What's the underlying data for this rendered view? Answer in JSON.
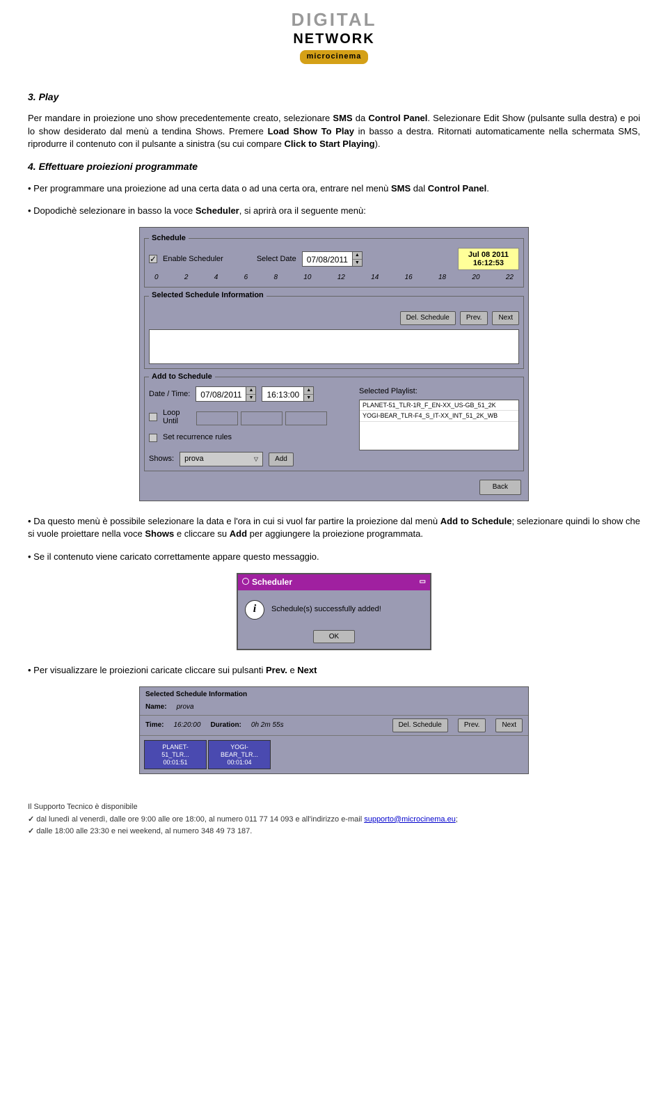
{
  "logo": {
    "line1": "DIGITAL",
    "line2": "NETWORK",
    "line3": "microcinema"
  },
  "sec3": {
    "title": "3. Play",
    "p1a": "Per mandare in proiezione uno show precedentemente creato, selezionare ",
    "p1b": "SMS",
    "p1c": " da ",
    "p1d": "Control Panel",
    "p1e": ". Selezionare Edit Show (pulsante sulla destra) e poi lo show desiderato dal menù a tendina Shows. Premere ",
    "p1f": "Load Show To Play",
    "p1g": " in basso a destra. Ritornati automaticamente nella schermata SMS, riprodurre il contenuto con il pulsante a sinistra (su cui compare ",
    "p1h": "Click to Start Playing",
    "p1i": ")."
  },
  "sec4": {
    "title": "4. Effettuare proiezioni programmate",
    "b1a": "Per programmare una proiezione ad una certa data o ad una certa ora, entrare nel menù ",
    "b1b": "SMS",
    "b1c": " dal ",
    "b1d": "Control Panel",
    "b1e": ".",
    "b2a": "Dopodichè selezionare in basso la voce ",
    "b2b": "Scheduler",
    "b2c": ", si aprirà ora il seguente menù:"
  },
  "scheduler": {
    "fs_schedule": "Schedule",
    "enable": "Enable Scheduler",
    "select_date": "Select Date",
    "date_value": "07/08/2011",
    "display_date": "Jul 08 2011",
    "display_time": "16:12:53",
    "ticks": [
      "0",
      "2",
      "4",
      "6",
      "8",
      "10",
      "12",
      "14",
      "16",
      "18",
      "20",
      "22"
    ],
    "fs_selected": "Selected Schedule Information",
    "btn_del": "Del. Schedule",
    "btn_prev": "Prev.",
    "btn_next": "Next",
    "fs_add": "Add to Schedule",
    "datetime_label": "Date / Time:",
    "date2": "07/08/2011",
    "time2": "16:13:00",
    "selected_playlist": "Selected Playlist:",
    "playlist_items": [
      "PLANET-51_TLR-1R_F_EN-XX_US-GB_51_2K",
      "YOGI-BEAR_TLR-F4_S_IT-XX_INT_51_2K_WB"
    ],
    "loop_until": "Loop Until",
    "set_recur": "Set recurrence rules",
    "shows_label": "Shows:",
    "shows_value": "prova",
    "btn_add": "Add",
    "btn_back": "Back"
  },
  "after_scheduler": {
    "b1a": "Da questo menù è possibile selezionare la data e l'ora in cui si vuol far partire la proiezione dal menù ",
    "b1b": "Add to Schedule",
    "b1c": "; selezionare quindi lo show che si vuole proiettare nella voce ",
    "b1d": "Shows",
    "b1e": " e cliccare su ",
    "b1f": "Add",
    "b1g": " per aggiungere la proiezione programmata.",
    "b2": "Se il contenuto viene caricato correttamente appare questo messaggio."
  },
  "dialog": {
    "title": "Scheduler",
    "msg": "Schedule(s) successfully added!",
    "ok": "OK"
  },
  "after_dialog": {
    "b1a": "Per visualizzare le proiezioni caricate cliccare sui pulsanti ",
    "b1b": "Prev.",
    "b1c": " e ",
    "b1d": "Next"
  },
  "sel_info": {
    "legend": "Selected Schedule Information",
    "name_lbl": "Name:",
    "name_val": "prova",
    "time_lbl": "Time:",
    "time_val": "16:20:00",
    "dur_lbl": "Duration:",
    "dur_val": "0h 2m 55s",
    "tiles": [
      {
        "name": "PLANET-51_TLR...",
        "dur": "00:01:51"
      },
      {
        "name": "YOGI-BEAR_TLR...",
        "dur": "00:01:04"
      }
    ]
  },
  "footer": {
    "line1": "Il Supporto Tecnico è disponibile",
    "line2a": "dal lunedì al venerdì, dalle ore 9:00 alle ore 18:00, al numero 011 77 14 093 e all'indirizzo e-mail ",
    "line2b": "supporto@microcinema.eu",
    "line2c": ";",
    "line3": "dalle 18:00 alle 23:30 e nei weekend, al numero 348 49 73 187."
  }
}
